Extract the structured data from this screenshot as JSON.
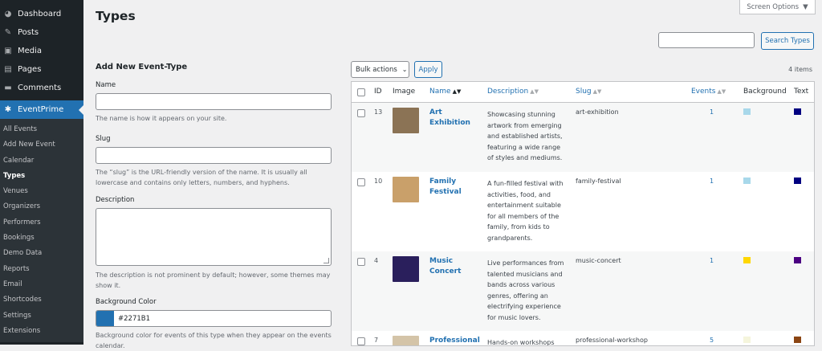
{
  "sidebar": {
    "top": [
      {
        "label": "Dashboard",
        "icon": "dashboard-icon",
        "glyph": "◕"
      },
      {
        "label": "Posts",
        "icon": "pin-icon",
        "glyph": "✎"
      },
      {
        "label": "Media",
        "icon": "media-icon",
        "glyph": "▣"
      },
      {
        "label": "Pages",
        "icon": "pages-icon",
        "glyph": "▤"
      },
      {
        "label": "Comments",
        "icon": "comments-icon",
        "glyph": "▬"
      },
      {
        "label": "EventPrime",
        "icon": "ticket-icon",
        "glyph": "✱"
      }
    ],
    "sub": [
      "All Events",
      "Add New Event",
      "Calendar",
      "Types",
      "Venues",
      "Organizers",
      "Performers",
      "Bookings",
      "Demo Data",
      "Reports",
      "Email",
      "Shortcodes",
      "Settings",
      "Extensions"
    ]
  },
  "page": {
    "title": "Types",
    "screen_options": "Screen Options",
    "search_button": "Search Types",
    "search_value": ""
  },
  "form": {
    "heading": "Add New Event-Type",
    "name_label": "Name",
    "name_desc": "The name is how it appears on your site.",
    "slug_label": "Slug",
    "slug_desc": "The “slug” is the URL-friendly version of the name. It is usually all lowercase and contains only letters, numbers, and hyphens.",
    "desc_label": "Description",
    "desc_desc": "The description is not prominent by default; however, some themes may show it.",
    "bg_label": "Background Color",
    "bg_value": "#2271B1",
    "bg_desc": "Background color for events of this type when they appear on the events calendar."
  },
  "list": {
    "bulk_label": "Bulk actions",
    "apply_label": "Apply",
    "items_count": "4 items",
    "columns": {
      "id": "ID",
      "image": "Image",
      "name": "Name",
      "description": "Description",
      "slug": "Slug",
      "events": "Events",
      "background": "Background",
      "text": "Text"
    },
    "rows": [
      {
        "id": "13",
        "name": "Art Exhibition",
        "description": "Showcasing stunning artwork from emerging and established artists, featuring a wide range of styles and mediums.",
        "slug": "art-exhibition",
        "events": "1",
        "bg": "#a8d8ea",
        "text": "#000080",
        "thumb": "#8b7355"
      },
      {
        "id": "10",
        "name": "Family Festival",
        "description": "A fun-filled festival with activities, food, and entertainment suitable for all members of the family, from kids to grandparents.",
        "slug": "family-festival",
        "events": "1",
        "bg": "#a8d8ea",
        "text": "#000080",
        "thumb": "#c9a06a"
      },
      {
        "id": "4",
        "name": "Music Concert",
        "description": "Live performances from talented musicians and bands across various genres, offering an electrifying experience for music lovers.",
        "slug": "music-concert",
        "events": "1",
        "bg": "#ffd700",
        "text": "#4b0082",
        "thumb": "#2a1f5c"
      },
      {
        "id": "7",
        "name": "Professional",
        "description": "Hands-on workshops",
        "slug": "professional-workshop",
        "events": "5",
        "bg": "#f5f5dc",
        "text": "#8b4513",
        "thumb": "#d4c4a8"
      }
    ]
  }
}
